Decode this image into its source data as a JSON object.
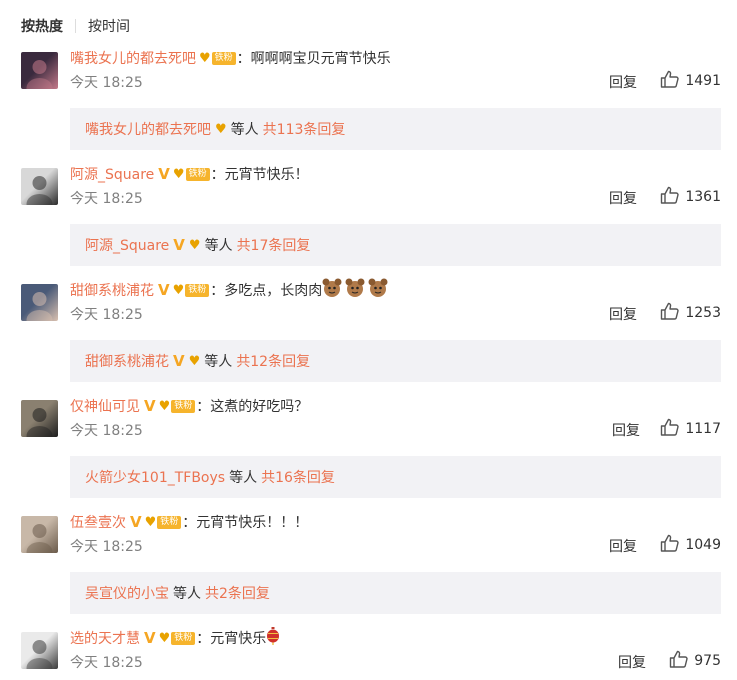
{
  "sort": {
    "active": "按热度",
    "other": "按时间"
  },
  "comments": [
    {
      "username": "嘴我女儿的都去死吧",
      "verified": false,
      "fan_label": "铁粉",
      "text": "啊啊啊宝贝元宵节快乐",
      "time": "今天 18:25",
      "reply_label": "回复",
      "likes": "1491",
      "reply_user": "嘴我女儿的都去死吧",
      "reply_etc": "等人",
      "reply_count": "共113条回复",
      "avatar_colors": [
        "#3a2a3e",
        "#c47a8a"
      ]
    },
    {
      "username": "阿源_Square",
      "verified": true,
      "fan_label": "铁粉",
      "text": "元宵节快乐！",
      "time": "今天 18:25",
      "reply_label": "回复",
      "likes": "1361",
      "reply_user": "阿源_Square",
      "reply_etc": "等人",
      "reply_count": "共17条回复",
      "avatar_colors": [
        "#d8d8d8",
        "#2a2a2a"
      ]
    },
    {
      "username": "甜御系桃浦花",
      "verified": true,
      "fan_label": "铁粉",
      "text": "多吃点，长肉肉",
      "time": "今天 18:25",
      "reply_label": "回复",
      "likes": "1253",
      "reply_user": "甜御系桃浦花",
      "reply_etc": "等人",
      "reply_count": "共12条回复",
      "avatar_colors": [
        "#4a5a78",
        "#d9c0b0"
      ]
    },
    {
      "username": "仅神仙可见",
      "verified": true,
      "fan_label": "铁粉",
      "text": "这煮的好吃吗？",
      "time": "今天 18:25",
      "reply_label": "回复",
      "likes": "1117",
      "reply_user": "火箭少女101_TFBoys",
      "reply_etc": "等人",
      "reply_count": "共16条回复",
      "avatar_colors": [
        "#8a8070",
        "#1e1e1e"
      ]
    },
    {
      "username": "伍叁壹次",
      "verified": true,
      "fan_label": "铁粉",
      "text": "元宵节快乐！！！",
      "time": "今天 18:25",
      "reply_label": "回复",
      "likes": "1049",
      "reply_user": "吴宣仪的小宝",
      "reply_etc": "等人",
      "reply_count": "共2条回复",
      "avatar_colors": [
        "#c8b8a8",
        "#6a5a4a"
      ]
    },
    {
      "username": "选的天才慧",
      "verified": true,
      "fan_label": "铁粉",
      "text": "元宵快乐",
      "time": "今天 18:25",
      "reply_label": "回复",
      "likes": "975",
      "reply_user": "",
      "reply_etc": "",
      "reply_count": "",
      "avatar_colors": [
        "#eaeaea",
        "#3a3a3a"
      ]
    }
  ],
  "colors": {
    "accent": "#eb7350",
    "fan_badge": "#f6b42c",
    "reply_bg": "#f2f2f5"
  },
  "icons": {
    "like": "thumbs-up-icon",
    "verified": "verified-v-icon",
    "fan": "fan-heart-icon"
  }
}
